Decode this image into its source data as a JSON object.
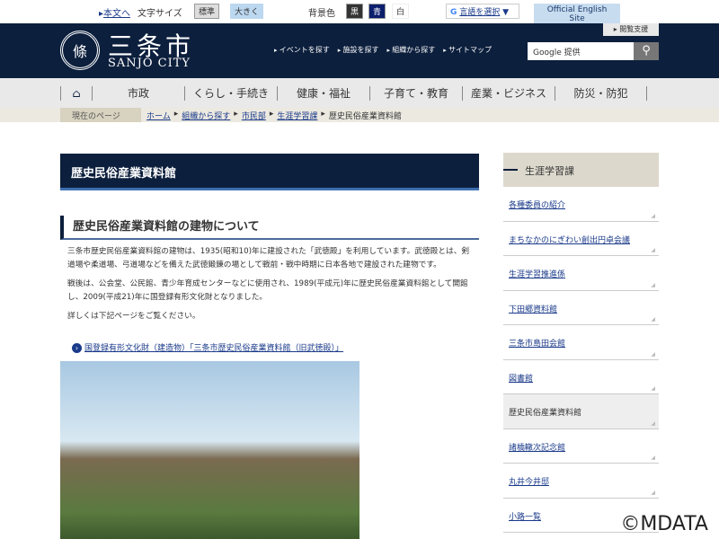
{
  "top": {
    "skip": "本文へ",
    "font_size_label": "文字サイズ",
    "size_normal": "標準",
    "size_large": "大きく",
    "bg_label": "背景色",
    "bg_black": "黒",
    "bg_blue": "青",
    "bg_white": "白",
    "translate": "言語を選択",
    "english": "Official English Site"
  },
  "header": {
    "logo_mark": "條",
    "logo_jp": "三条市",
    "logo_en": "SANJO CITY",
    "assist": "閲覧支援",
    "links": [
      "イベントを探す",
      "施設を探す",
      "組織から探す",
      "サイトマップ"
    ],
    "search_placeholder": "Google 提供",
    "search_icon": "search-icon"
  },
  "nav": [
    "市政",
    "くらし・手続き",
    "健康・福祉",
    "子育て・教育",
    "産業・ビジネス",
    "防災・防犯"
  ],
  "breadcrumb": {
    "here": "現在のページ",
    "items": [
      "ホーム",
      "組織から探す",
      "市民部",
      "生涯学習課"
    ],
    "current": "歴史民俗産業資料館"
  },
  "main": {
    "title": "歴史民俗産業資料館",
    "heading": "歴史民俗産業資料館の建物について",
    "paragraphs": [
      "三条市歴史民俗産業資料館の建物は、1935(昭和10)年に建設された「武徳殿」を利用しています。武徳殿とは、剣道場や柔道場、弓道場などを備えた武徳鍛錬の場として戦前・戦中時期に日本各地で建設された建物です。",
      "戦後は、公会堂、公民館、青少年育成センターなどに使用され、1989(平成元)年に歴史民俗産業資料館として開館し、2009(平成21)年に国登録有形文化財となりました。",
      "詳しくは下記ページをご覧ください。"
    ],
    "link": "国登録有形文化財（建造物）「三条市歴史民俗産業資料館（旧武徳殿）」"
  },
  "sidebar": {
    "title": "生涯学習課",
    "items": [
      "各種委員の紹介",
      "まちなかのにぎわい創出円卓会議",
      "生涯学習推進係",
      "下田郷資料館",
      "三条市島田会館",
      "図書館",
      "歴史民俗産業資料館",
      "諸橋轍次記念館",
      "丸井今井邸",
      "小路一覧"
    ],
    "current_index": 6
  },
  "watermark": "©MDATA"
}
